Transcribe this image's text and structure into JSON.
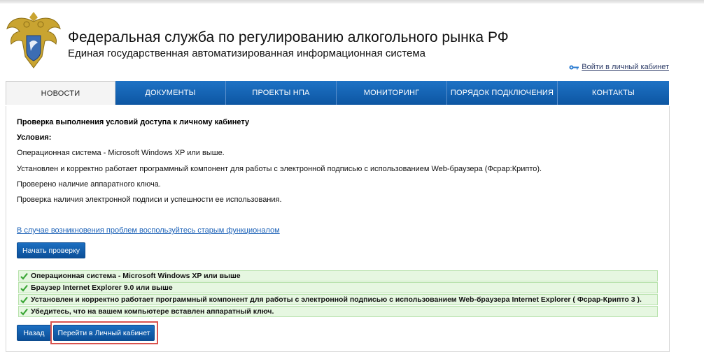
{
  "header": {
    "title": "Федеральная служба по регулированию алкогольного рынка РФ",
    "subtitle": "Единая государственная автоматизированная информационная система",
    "login_link": "Войти в личный кабинет",
    "logo_icon": "coat-of-arms-emblem",
    "login_icon": "key-icon"
  },
  "nav": {
    "items": [
      {
        "label": "НОВОСТИ",
        "active": true
      },
      {
        "label": "ДОКУМЕНТЫ",
        "active": false
      },
      {
        "label": "ПРОЕКТЫ НПА",
        "active": false
      },
      {
        "label": "МОНИТОРИНГ",
        "active": false
      },
      {
        "label": "ПОРЯДОК ПОДКЛЮЧЕНИЯ",
        "active": false
      },
      {
        "label": "КОНТАКТЫ",
        "active": false
      }
    ]
  },
  "main": {
    "title": "Проверка выполнения условий доступа к личному кабинету",
    "conditions_label": "Условия:",
    "conditions": [
      "Операционная система - Microsoft Windows XP или выше.",
      "Установлен и корректно работает программный компонент для работы с электронной подписью с использованием Web-браузера (Фсрар:Крипто).",
      "Проверено наличие аппаратного ключа.",
      "Проверка наличия электронной подписи и успешности ее использования."
    ],
    "old_functional_link": "В случае возникновения проблем воспользуйтесь старым функционалом",
    "start_button": "Начать проверку",
    "check_results": [
      "Операционная система - Microsoft Windows XP или выше",
      "Браузер Internet Explorer 9.0 или выше",
      "Установлен и корректно работает программный компонент для работы с электронной подписью с использованием Web-браузера Internet Explorer ( Фсрар-Крипто 3 ).",
      "Убедитесь, что на вашем компьютере вставлен аппаратный ключ."
    ],
    "back_button": "Назад",
    "go_button": "Перейти в Личный кабинет"
  },
  "colors": {
    "nav_blue": "#0d56a2",
    "check_bg": "#e6f7e1",
    "check_green": "#3aa635",
    "highlight_red": "#d9534f",
    "link_blue": "#1e63b8"
  }
}
